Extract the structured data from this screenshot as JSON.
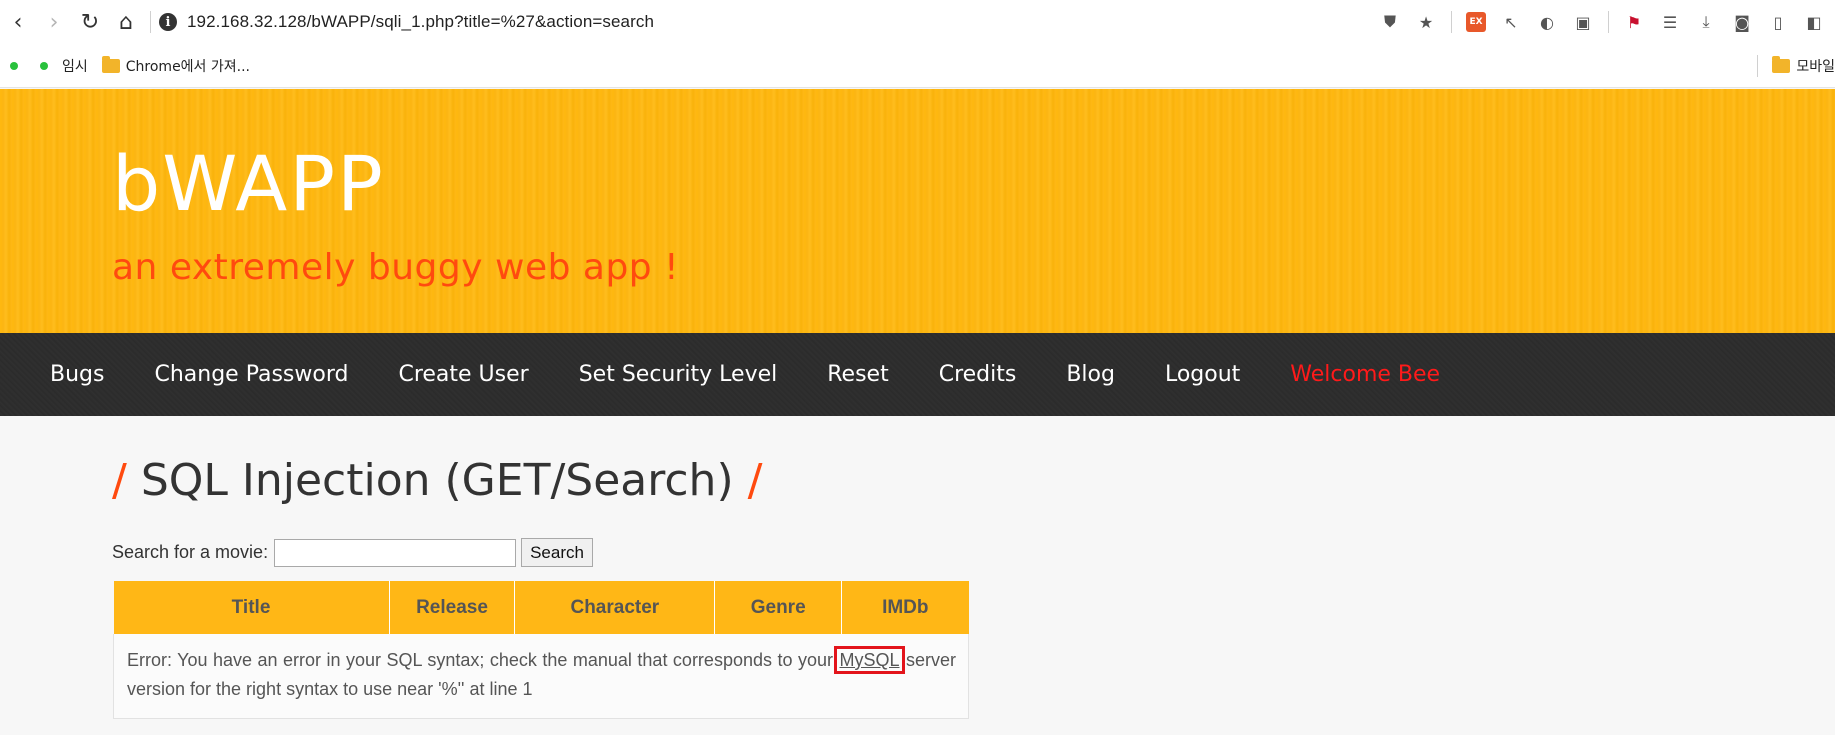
{
  "browser": {
    "url": "192.168.32.128/bWAPP/sqli_1.php?title=%27&action=search",
    "back_icon": "‹",
    "forward_icon": "›",
    "reload_icon": "↻",
    "home_icon": "⌂",
    "ext_label": "EX",
    "bookmarks": {
      "item1": "임시",
      "item2": "Chrome에서 가져...",
      "right_folder": "모바일"
    }
  },
  "header": {
    "logo": "bWAPP",
    "tagline": "an extremely buggy web app !"
  },
  "menu": {
    "items": [
      "Bugs",
      "Change Password",
      "Create User",
      "Set Security Level",
      "Reset",
      "Credits",
      "Blog",
      "Logout"
    ],
    "welcome": "Welcome Bee"
  },
  "main": {
    "title_slash_left": "/",
    "title": "SQL Injection (GET/Search)",
    "title_slash_right": "/",
    "search_label": "Search for a movie:",
    "search_value": "",
    "search_button": "Search",
    "table": {
      "headers": [
        "Title",
        "Release",
        "Character",
        "Genre",
        "IMDb"
      ],
      "error_prefix": "Error: You have an error in your SQL syntax; check the manual that corresponds to your ",
      "error_link": "MySQL",
      "error_suffix": " server version for the right syntax to use near '%'' at line 1"
    }
  },
  "colors": {
    "header_bg": "#ffb90f",
    "tagline": "#ff4a0f",
    "welcome": "#ff1a1a",
    "highlight_box": "#e3141b"
  }
}
